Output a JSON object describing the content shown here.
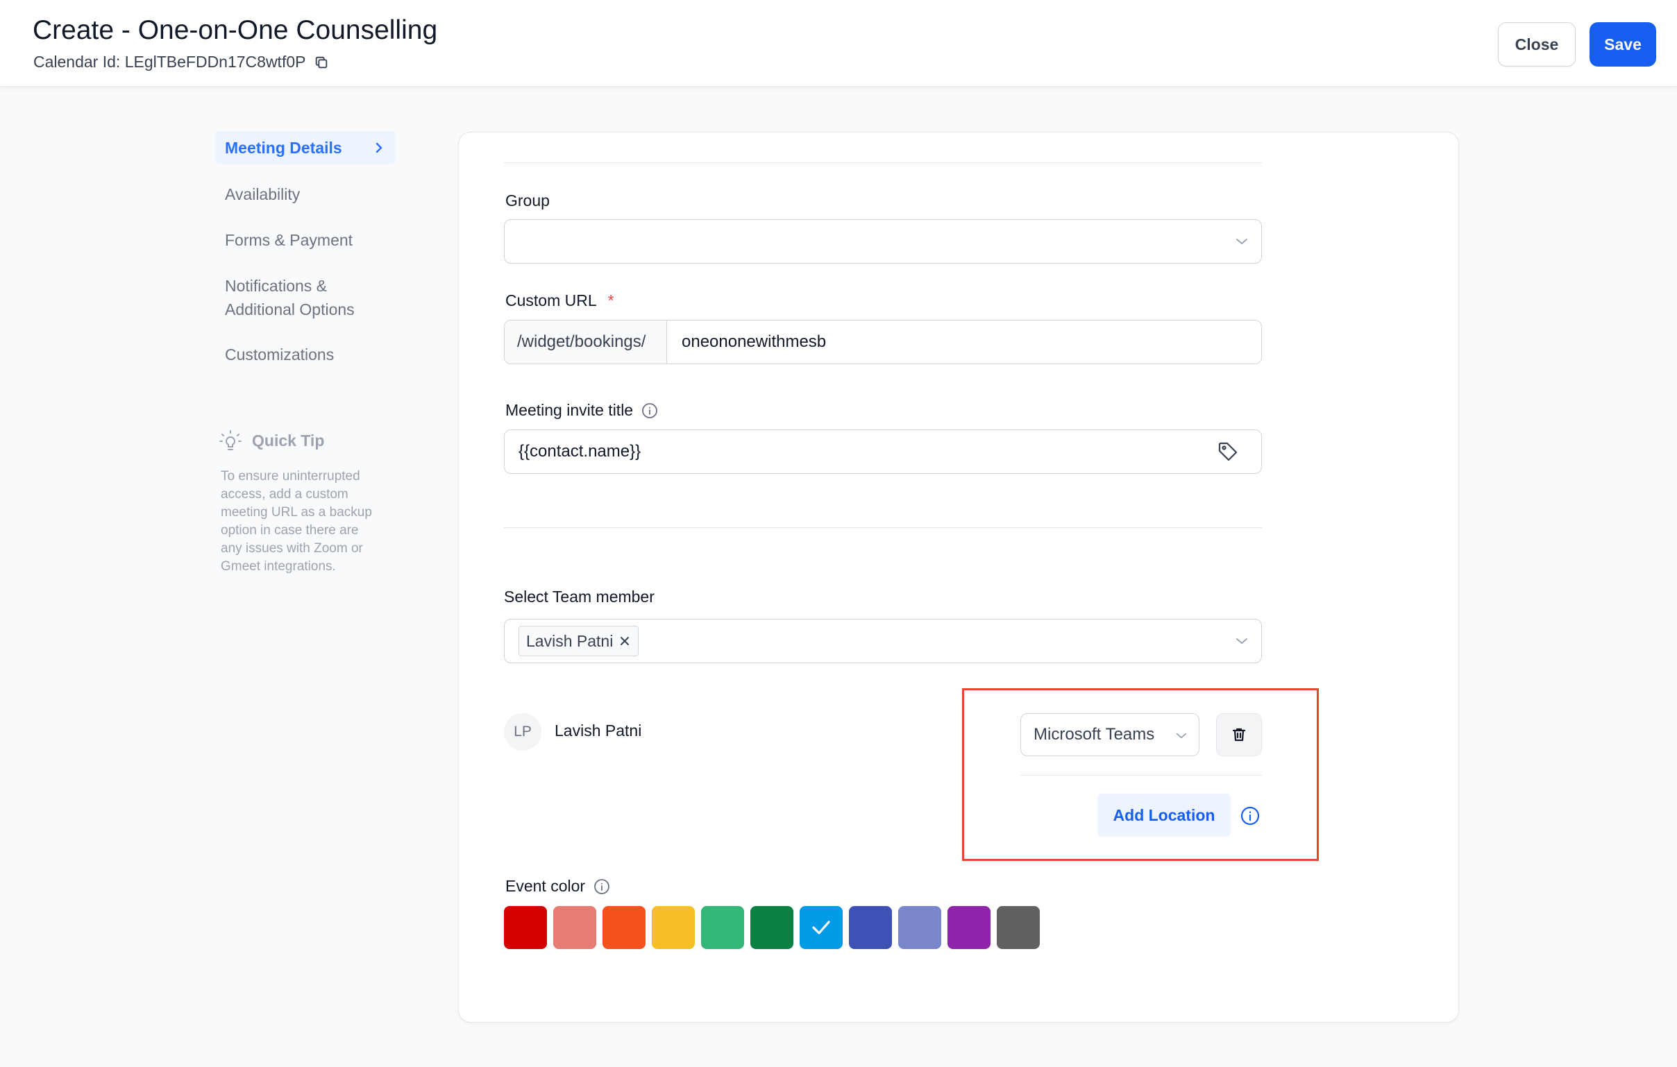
{
  "header": {
    "title": "Create - One-on-One Counselling",
    "calendar_id_label": "Calendar Id: LEglTBeFDDn17C8wtf0P",
    "close_label": "Close",
    "save_label": "Save"
  },
  "nav": {
    "items": [
      {
        "label": "Meeting Details",
        "active": true
      },
      {
        "label": "Availability",
        "active": false
      },
      {
        "label": "Forms & Payment",
        "active": false
      },
      {
        "label": "Notifications &",
        "label2": "Additional Options",
        "active": false
      },
      {
        "label": "Customizations",
        "active": false
      }
    ]
  },
  "quick_tip": {
    "title": "Quick Tip",
    "lines": [
      "To ensure uninterrupted",
      "access, add a custom",
      "meeting URL as a backup",
      "option in case there are",
      "any issues with Zoom or",
      "Gmeet integrations."
    ]
  },
  "form": {
    "group_label": "Group",
    "group_value": "",
    "custom_url_label": "Custom URL",
    "required_mark": "*",
    "custom_url_prefix": "/widget/bookings/",
    "custom_url_value": "oneononewithmesb",
    "invite_title_label": "Meeting invite title",
    "invite_title_value": "{{contact.name}}",
    "team_member_label": "Select Team member",
    "team_member_chip": "Lavish Patni",
    "member": {
      "initials": "LP",
      "name": "Lavish Patni",
      "location_value": "Microsoft Teams",
      "add_location_label": "Add Location"
    },
    "event_color_label": "Event color",
    "event_colors": [
      {
        "hex": "#d50000",
        "selected": false
      },
      {
        "hex": "#e67c73",
        "selected": false
      },
      {
        "hex": "#f4511e",
        "selected": false
      },
      {
        "hex": "#f6bf26",
        "selected": false
      },
      {
        "hex": "#33b679",
        "selected": false
      },
      {
        "hex": "#0b8043",
        "selected": false
      },
      {
        "hex": "#039be5",
        "selected": true
      },
      {
        "hex": "#3f51b5",
        "selected": false
      },
      {
        "hex": "#7986cb",
        "selected": false
      },
      {
        "hex": "#8e24aa",
        "selected": false
      },
      {
        "hex": "#616161",
        "selected": false
      }
    ]
  },
  "colors": {
    "primary": "#155eef",
    "highlight_border": "#e8472f"
  }
}
